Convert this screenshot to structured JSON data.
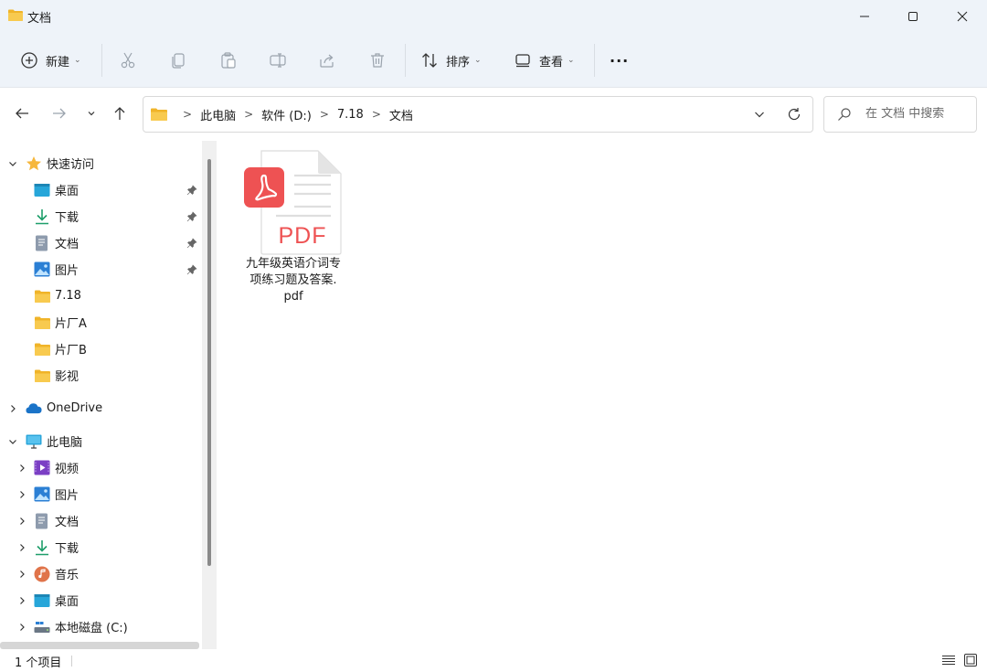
{
  "window": {
    "title": "文档",
    "minimize_icon": "minimize-icon",
    "maximize_icon": "maximize-icon",
    "close_icon": "close-icon"
  },
  "toolbar": {
    "new_label": "新建",
    "sort_label": "排序",
    "view_label": "查看",
    "more_label": "···",
    "icons": [
      "plus-circle-icon",
      "cut-icon",
      "copy-icon",
      "paste-icon",
      "rename-icon",
      "share-icon",
      "delete-icon",
      "sort-icon",
      "view-icon",
      "more-icon"
    ]
  },
  "addressbar": {
    "breadcrumbs": [
      "此电脑",
      "软件 (D:)",
      "7.18",
      "文档"
    ],
    "separator": ">"
  },
  "search": {
    "placeholder": "在 文档 中搜索"
  },
  "navpane": {
    "quick_access_label": "快速访问",
    "quick_items": [
      {
        "label": "桌面",
        "icon": "desktop-icon",
        "pinned": true
      },
      {
        "label": "下载",
        "icon": "download-icon",
        "pinned": true
      },
      {
        "label": "文档",
        "icon": "document-icon",
        "pinned": true
      },
      {
        "label": "图片",
        "icon": "picture-icon",
        "pinned": true
      },
      {
        "label": "7.18",
        "icon": "folder-icon",
        "pinned": false
      },
      {
        "label": "片厂A",
        "icon": "folder-icon",
        "pinned": false
      },
      {
        "label": "片厂B",
        "icon": "folder-icon",
        "pinned": false
      },
      {
        "label": "影视",
        "icon": "folder-icon",
        "pinned": false
      }
    ],
    "onedrive_label": "OneDrive",
    "this_pc_label": "此电脑",
    "pc_items": [
      {
        "label": "视频",
        "icon": "video-icon"
      },
      {
        "label": "图片",
        "icon": "picture-icon"
      },
      {
        "label": "文档",
        "icon": "document-icon"
      },
      {
        "label": "下载",
        "icon": "download-icon"
      },
      {
        "label": "音乐",
        "icon": "music-icon"
      },
      {
        "label": "桌面",
        "icon": "desktop-icon"
      },
      {
        "label": "本地磁盘 (C:)",
        "icon": "drive-icon"
      }
    ]
  },
  "content": {
    "files": [
      {
        "name_line1": "九年级英语介词专",
        "name_line2": "项练习题及答案.",
        "name_line3": "pdf",
        "badge": "PDF",
        "icon": "pdf-file-icon"
      }
    ]
  },
  "status": {
    "count_text": "1 个项目"
  },
  "colors": {
    "titlebar_bg": "#eef3f9",
    "pdf_red": "#ee5253",
    "folder_yellow": "#f7c548",
    "accent_blue": "#1a73c8"
  }
}
